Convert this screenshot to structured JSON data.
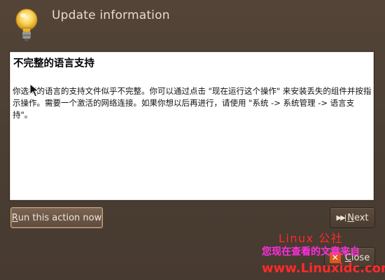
{
  "window": {
    "title": "Update information"
  },
  "content": {
    "heading": "不完整的语言支持",
    "body": "你选择的语言的支持文件似乎不完整。你可以通过点击 \"现在运行这个操作\" 来安装丢失的组件并按指示操作。需要一个激活的网络连接。如果你想以后再进行，请使用 \"系统 -> 系统管理 -> 语言支持\"。"
  },
  "buttons": {
    "run_mnemonic": "R",
    "run_rest": "un this action now",
    "next_mnemonic": "N",
    "next_rest": "ext",
    "close_mnemonic": "C",
    "close_rest": "lose"
  },
  "watermark": {
    "line1": "Linux 公社",
    "line2": "您现在查看的文章来自",
    "line3": "www.Linuxidc.com"
  },
  "icons": {
    "bulb": "lightbulb-icon",
    "next": "skip-forward-icon",
    "close": "close-icon",
    "cursor": "mouse-pointer-icon"
  },
  "colors": {
    "background": "#4b3e33",
    "title_text": "#e8dccd",
    "close_icon": "#e0561b",
    "watermark_red": "#ff2a2a",
    "watermark_magenta": "#ff2de0"
  }
}
